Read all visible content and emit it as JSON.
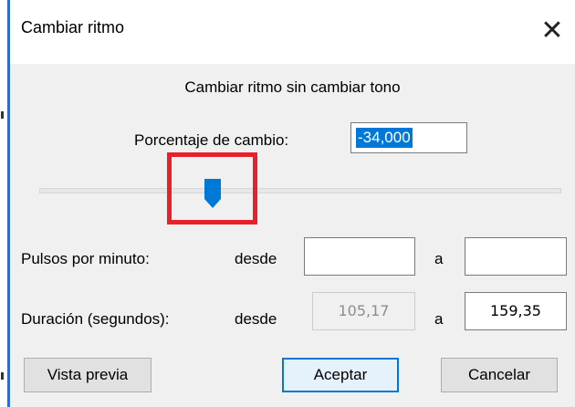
{
  "dialog": {
    "title": "Cambiar ritmo",
    "close_glyph": "✕",
    "subtitle": "Cambiar ritmo sin cambiar tono"
  },
  "percent": {
    "label": "Porcentaje de cambio:",
    "value": "-34,000"
  },
  "slider": {
    "value_percent": -34
  },
  "bpm": {
    "label": "Pulsos por minuto:",
    "from_label": "desde",
    "from_value": "",
    "to_label": "a",
    "to_value": ""
  },
  "duration": {
    "label": "Duración (segundos):",
    "from_label": "desde",
    "from_value": "105,17",
    "to_label": "a",
    "to_value": "159,35"
  },
  "buttons": {
    "preview": "Vista previa",
    "accept": "Aceptar",
    "cancel": "Cancelar"
  },
  "colors": {
    "accent": "#0078d7",
    "highlight": "#e8202a"
  }
}
